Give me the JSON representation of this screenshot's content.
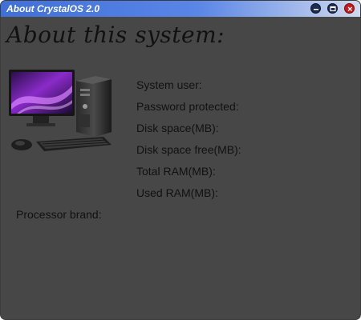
{
  "window": {
    "title": "About CrystalOS 2.0",
    "accent": "#3f6fd8",
    "background": "#474747",
    "controls": {
      "minimize_icon": "minimize-icon",
      "maximize_icon": "maximize-icon",
      "close_icon": "close-icon",
      "close_color": "#c71919"
    }
  },
  "content": {
    "heading": "About this system:",
    "image_icon": "desktop-computer-icon",
    "fields": [
      {
        "label": "System user:"
      },
      {
        "label": "Password protected:"
      },
      {
        "label": "Disk space(MB):"
      },
      {
        "label": "Disk space free(MB):"
      },
      {
        "label": "Total RAM(MB):"
      },
      {
        "label": "Used RAM(MB):"
      }
    ],
    "processor_label": "Processor brand:"
  }
}
